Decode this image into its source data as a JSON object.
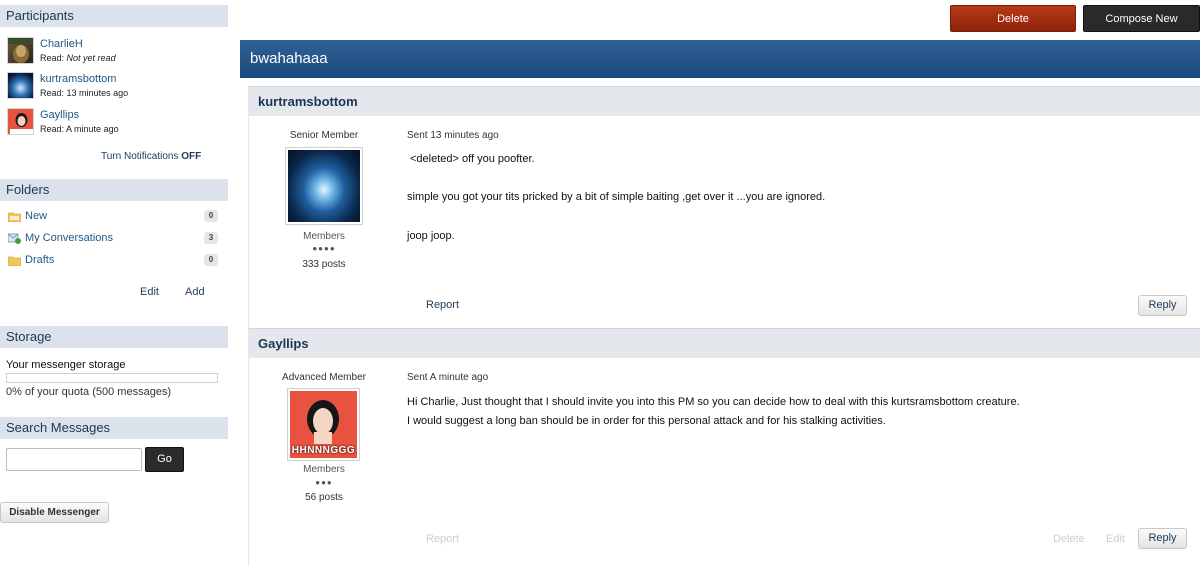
{
  "sidebar": {
    "participants_title": "Participants",
    "participants": [
      {
        "name": "CharlieH",
        "read_label": "Read:",
        "read_value": "Not yet read",
        "italic": true
      },
      {
        "name": "kurtramsbottom",
        "read_label": "Read:",
        "read_value": "13 minutes ago",
        "italic": false
      },
      {
        "name": "Gayllips",
        "read_label": "Read:",
        "read_value": "A minute ago",
        "italic": false
      }
    ],
    "notifications_text": "Turn Notifications",
    "notifications_state": "OFF",
    "folders_title": "Folders",
    "folders": [
      {
        "label": "New",
        "count": "0",
        "icon": "folder-new-icon"
      },
      {
        "label": "My Conversations",
        "count": "3",
        "icon": "conversations-icon"
      },
      {
        "label": "Drafts",
        "count": "0",
        "icon": "folder-icon"
      }
    ],
    "edit_label": "Edit",
    "add_label": "Add",
    "storage_title": "Storage",
    "storage_label": "Your messenger storage",
    "storage_quota": "0% of your quota (500 messages)",
    "storage_fraction": 0,
    "search_title": "Search Messages",
    "search_value": "",
    "go_label": "Go",
    "disable_label": "Disable Messenger"
  },
  "toolbar": {
    "delete_label": "Delete",
    "compose_label": "Compose New"
  },
  "conversation": {
    "title": "bwahahaaa",
    "posts": [
      {
        "author": "kurtramsbottom",
        "rank": "Senior Member",
        "group": "Members",
        "pips": "●●●●",
        "posts": "333 posts",
        "sent": "Sent 13 minutes ago",
        "lines": [
          "<deleted> off you poofter.",
          "simple you got your tits pricked by a bit of simple baiting ,get over it ...you are ignored.",
          "joop joop."
        ],
        "report": "Report",
        "reply": "Reply"
      },
      {
        "author": "Gayllips",
        "rank": "Advanced Member",
        "group": "Members",
        "pips": "●●●",
        "posts": "56 posts",
        "sent": "Sent A minute ago",
        "lines": [
          "Hi Charlie, Just thought that I should invite you into this PM so you can decide how to deal with this kurtsramsbottom creature.",
          "I would suggest a long ban should be in order for this personal attack and for his stalking activities."
        ],
        "avatar_caption": "HHNNNGGG",
        "report": "Report",
        "delete": "Delete",
        "edit": "Edit",
        "reply": "Reply"
      }
    ]
  }
}
